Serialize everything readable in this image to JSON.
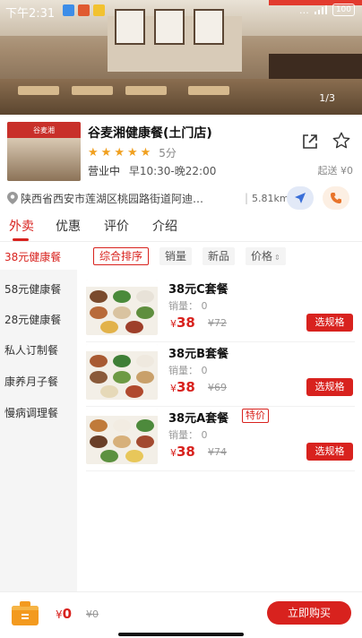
{
  "status_bar": {
    "time": "下午2:31",
    "right_text": "…",
    "battery": "100"
  },
  "banner": {
    "page_counter": "1/3"
  },
  "store": {
    "logo_text": "谷麦湘",
    "name": "谷麦湘健康餐(土门店)",
    "stars": 5,
    "score": "5分",
    "status": "营业中",
    "hours": "早10:30-晚22:00",
    "delivery": "起送 ¥0",
    "address": "陕西省西安市莲湖区桃园路街道阿迪…",
    "distance": "5.81km"
  },
  "tabs": [
    {
      "label": "外卖",
      "active": true
    },
    {
      "label": "优惠",
      "active": false
    },
    {
      "label": "评价",
      "active": false
    },
    {
      "label": "介绍",
      "active": false
    }
  ],
  "sidebar": {
    "items": [
      {
        "label": "38元健康餐",
        "active": true
      },
      {
        "label": "58元健康餐",
        "active": false
      },
      {
        "label": "28元健康餐",
        "active": false
      },
      {
        "label": "私人订制餐",
        "active": false
      },
      {
        "label": "康养月子餐",
        "active": false
      },
      {
        "label": "慢病调理餐",
        "active": false
      }
    ]
  },
  "filters": {
    "sort": "综合排序",
    "sales": "销量",
    "new": "新品",
    "price": "价格"
  },
  "products": [
    {
      "name": "38元C套餐",
      "tag": "",
      "sales": "销量： 0",
      "yen": "¥",
      "price": "38",
      "original": "¥72",
      "button": "选规格"
    },
    {
      "name": "38元B套餐",
      "tag": "",
      "sales": "销量： 0",
      "yen": "¥",
      "price": "38",
      "original": "¥69",
      "button": "选规格"
    },
    {
      "name": "38元A套餐",
      "tag": "特价",
      "sales": "销量： 0",
      "yen": "¥",
      "price": "38",
      "original": "¥74",
      "button": "选规格"
    }
  ],
  "bottom_bar": {
    "yen": "¥",
    "total": "0",
    "original": "¥0",
    "buy_button": "立即购买"
  },
  "colors": {
    "accent": "#d8221e",
    "star": "#f0a020",
    "sidebar_bg": "#f5f5f5"
  }
}
